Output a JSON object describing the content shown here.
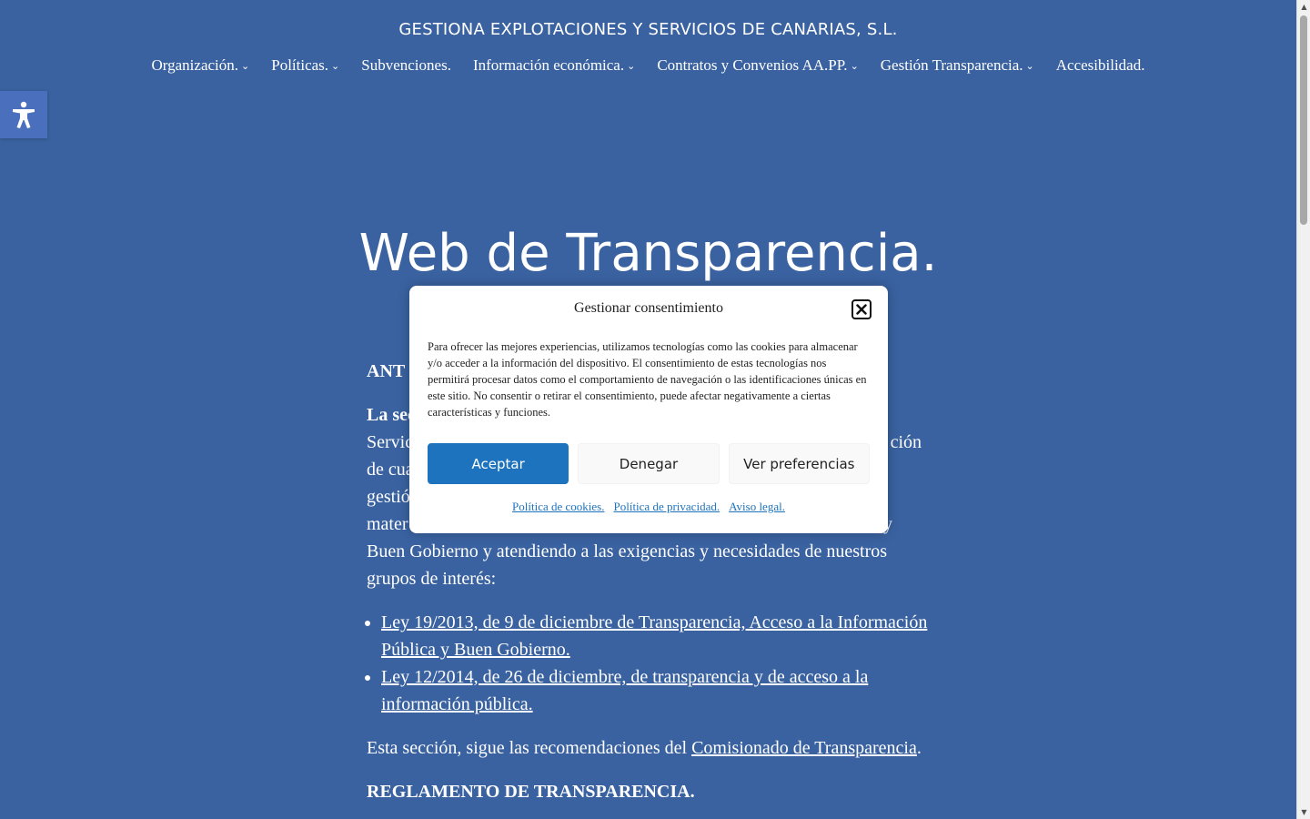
{
  "site": {
    "title": "GESTIONA EXPLOTACIONES Y SERVICIOS DE CANARIAS, S.L."
  },
  "nav": [
    {
      "label": "Organización.",
      "has_submenu": true
    },
    {
      "label": "Políticas.",
      "has_submenu": true
    },
    {
      "label": "Subvenciones.",
      "has_submenu": false
    },
    {
      "label": "Información económica.",
      "has_submenu": true
    },
    {
      "label": "Contratos y Convenios AA.PP.",
      "has_submenu": true
    },
    {
      "label": "Gestión Transparencia.",
      "has_submenu": true
    },
    {
      "label": "Accesibilidad.",
      "has_submenu": false
    }
  ],
  "icons": {
    "accessibility": "accessibility-icon",
    "close": "close-icon",
    "chevron": "chevron-down-icon"
  },
  "hero": {
    "title": "Web de Transparencia."
  },
  "content": {
    "heading_partial": "ANT",
    "para1_visible_start": "La sec",
    "para1_line2_start": "Servic",
    "para1_line2_end": "ción",
    "para1_line3_start": "de cua",
    "para1_line4_start": "gestió",
    "para1_line5_start": "mater",
    "para1_line5_end": "y",
    "para1_line6": "Buen Gobierno y atendiendo a las exigencias y necesidades de nuestros",
    "para1_line7": "grupos de interés:",
    "law_links": [
      "Ley 19/2013, de 9 de diciembre de Transparencia, Acceso a la Información Pública y Buen Gobierno.",
      "Ley 12/2014, de 26 de diciembre, de transparencia y de acceso a la información pública."
    ],
    "recommend_text": "Esta sección, sigue las recomendaciones del ",
    "recommend_link": "Comisionado de Transparencia",
    "recommend_end": ".",
    "section_heading": "REGLAMENTO DE TRANSPARENCIA."
  },
  "modal": {
    "title": "Gestionar consentimiento",
    "body": "Para ofrecer las mejores experiencias, utilizamos tecnologías como las cookies para almacenar y/o acceder a la información del dispositivo. El consentimiento de estas tecnologías nos permitirá procesar datos como el comportamiento de navegación o las identificaciones únicas en este sitio. No consentir o retirar el consentimiento, puede afectar negativamente a ciertas características y funciones.",
    "accept_label": "Aceptar",
    "deny_label": "Denegar",
    "prefs_label": "Ver preferencias",
    "links": [
      "Política de cookies.",
      "Política de privacidad.",
      "Aviso legal."
    ]
  },
  "colors": {
    "background": "#3a62a0",
    "accent": "#1e73be",
    "a11y_button": "#4a6fbd"
  }
}
